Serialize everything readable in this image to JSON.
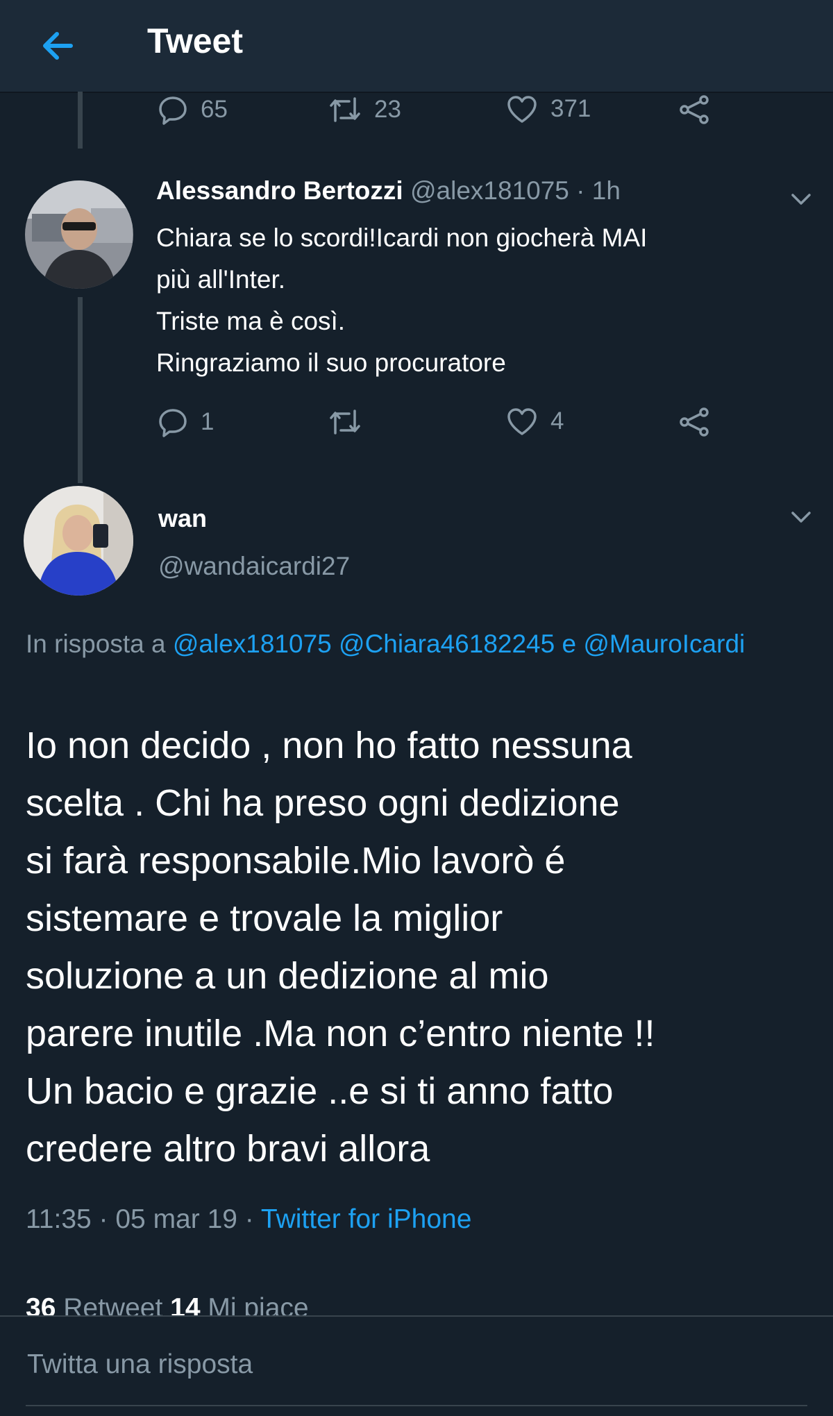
{
  "header": {
    "title": "Tweet",
    "back_icon": "arrow-left-icon",
    "accent": "#1da1f2"
  },
  "parent_tweet": {
    "actions": {
      "replies": "65",
      "retweets": "23",
      "likes": "371"
    }
  },
  "reply_tweet": {
    "name": "Alessandro Bertozzi",
    "meta": " @alex181075 · 1h",
    "lines": [
      "Chiara se lo scordi!Icardi non giocherà MAI",
      "più all'Inter.",
      "Triste ma è così.",
      "Ringraziamo il suo procuratore"
    ],
    "actions": {
      "replies": "1",
      "retweets": "",
      "likes": "4"
    }
  },
  "main_tweet": {
    "name": "wan",
    "handle": "@wandaicardi27",
    "in_reply_prefix": "In risposta a ",
    "in_reply_mentions": "@alex181075 @Chiara46182245 e @MauroIcardi",
    "text": "Io non decido , non ho fatto nessuna\nscelta . Chi ha preso ogni dedizione\nsi farà responsabile.Mio lavorò  é\nsistemare  e trovale la miglior\nsoluzione a un dedizione al mio\nparere inutile .Ma non c’entro niente !!\nUn bacio e grazie ..e si ti anno fatto\ncredere altro bravi allora",
    "time": "11:35 · 05 mar 19 · ",
    "source": "Twitter for iPhone",
    "retweet_count": "36",
    "retweet_label": " Retweet   ",
    "like_count": "14",
    "like_label": " Mi piace"
  },
  "compose": {
    "placeholder": "Twitta una risposta"
  },
  "colors": {
    "background": "#15202b",
    "header": "#1c2a38",
    "muted": "#8899a6",
    "link": "#1da1f2"
  }
}
